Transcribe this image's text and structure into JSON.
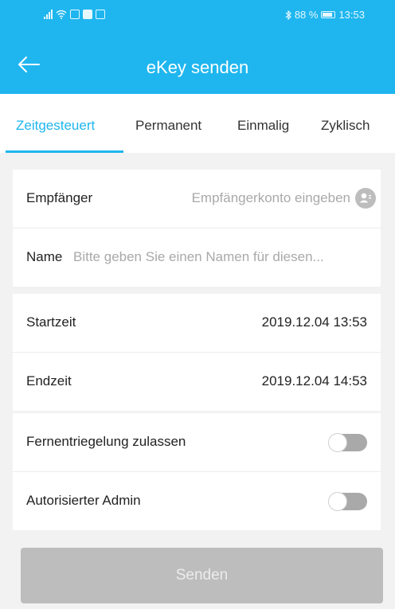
{
  "status_bar": {
    "battery": "88 %",
    "time": "13:53"
  },
  "header": {
    "title": "eKey senden",
    "back_icon": "arrow-left-icon"
  },
  "tabs": [
    {
      "label": "Zeitgesteuert",
      "active": true
    },
    {
      "label": "Permanent",
      "active": false
    },
    {
      "label": "Einmalig",
      "active": false
    },
    {
      "label": "Zyklisch",
      "active": false
    }
  ],
  "recipient": {
    "label": "Empfänger",
    "placeholder": "Empfängerkonto eingeben",
    "icon": "contact-icon"
  },
  "name": {
    "label": "Name",
    "placeholder": "Bitte geben Sie einen Namen für diesen..."
  },
  "start": {
    "label": "Startzeit",
    "value": "2019.12.04 13:53"
  },
  "end": {
    "label": "Endzeit",
    "value": "2019.12.04 14:53"
  },
  "remote_unlock": {
    "label": "Fernentriegelung zulassen",
    "enabled": false
  },
  "admin": {
    "label": "Autorisierter Admin",
    "enabled": false
  },
  "send_button": {
    "label": "Senden"
  },
  "colors": {
    "accent": "#1fb6ef",
    "disabled": "#bdbdbd",
    "background": "#f2f2f2"
  }
}
